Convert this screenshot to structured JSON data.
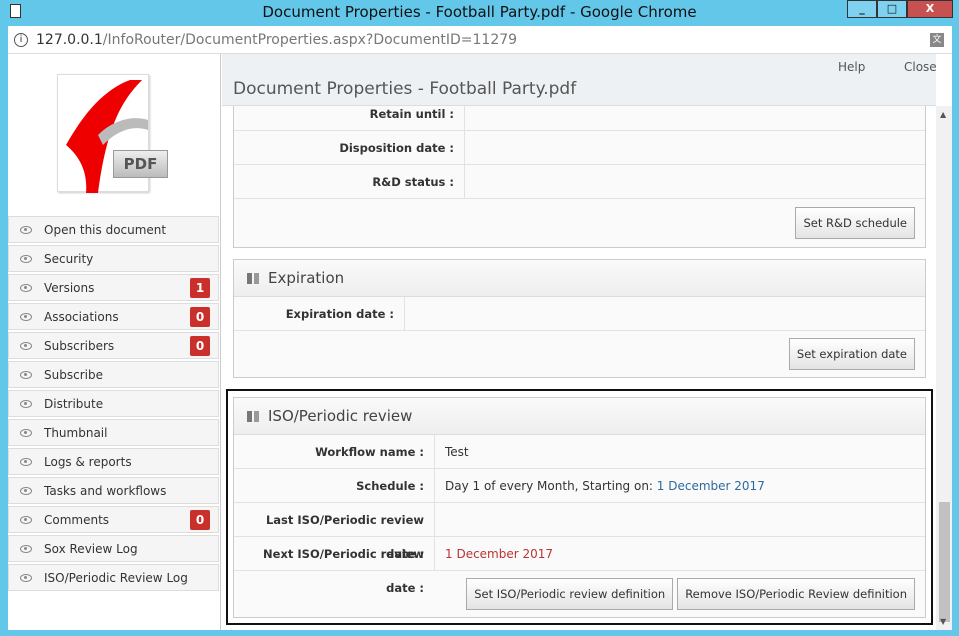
{
  "window": {
    "title": "Document Properties - Football Party.pdf - Google Chrome",
    "minimize": "_",
    "maximize": "□",
    "close": "X"
  },
  "address": {
    "host": "127.0.0.1",
    "path": "/InfoRouter/DocumentProperties.aspx?DocumentID=11279"
  },
  "thumbnail": {
    "label": "PDF"
  },
  "sidebar": {
    "items": [
      {
        "label": "Open this document"
      },
      {
        "label": "Security"
      },
      {
        "label": "Versions",
        "badge": "1"
      },
      {
        "label": "Associations",
        "badge": "0"
      },
      {
        "label": "Subscribers",
        "badge": "0"
      },
      {
        "label": "Subscribe"
      },
      {
        "label": "Distribute"
      },
      {
        "label": "Thumbnail"
      },
      {
        "label": "Logs & reports"
      },
      {
        "label": "Tasks and workflows"
      },
      {
        "label": "Comments",
        "badge": "0"
      },
      {
        "label": "Sox Review Log"
      },
      {
        "label": "ISO/Periodic Review Log"
      }
    ]
  },
  "header": {
    "help": "Help",
    "close": "Close",
    "title": "Document Properties - Football Party.pdf"
  },
  "rd": {
    "rows": [
      {
        "label": "Retain until :",
        "value": ""
      },
      {
        "label": "Disposition date :",
        "value": ""
      },
      {
        "label": "R&D status :",
        "value": ""
      }
    ],
    "button": "Set R&D schedule"
  },
  "expiration": {
    "title": "Expiration",
    "rows": [
      {
        "label": "Expiration date :",
        "value": ""
      }
    ],
    "button": "Set expiration date"
  },
  "iso": {
    "title": "ISO/Periodic review",
    "workflow_label": "Workflow name :",
    "workflow_value": "Test",
    "schedule_label": "Schedule :",
    "schedule_prefix": "Day 1 of every Month, Starting on: ",
    "schedule_date": "1 December 2017",
    "last_label": "Last ISO/Periodic review date :",
    "last_value": "",
    "next_label": "Next ISO/Periodic review date :",
    "next_value": "1 December 2017",
    "set_button": "Set ISO/Periodic review definition",
    "remove_button": "Remove ISO/Periodic Review definition"
  },
  "colors": {
    "badge": "#c9302c",
    "window": "#63c7ea",
    "link_date": "#2a6ba0",
    "next_date": "#bb3333"
  }
}
